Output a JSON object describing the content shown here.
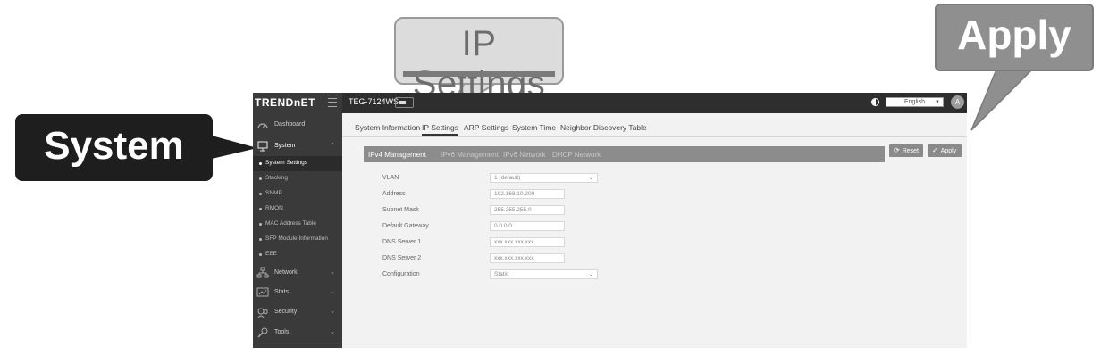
{
  "callouts": {
    "ip_settings": "IP Settings",
    "apply": "Apply",
    "system": "System"
  },
  "app": {
    "logo": "TRENDnET",
    "model": "TEG-7124WS",
    "language": "English",
    "avatar_initial": "A"
  },
  "sidebar": {
    "items": [
      {
        "label": "Dashboard",
        "icon": "dashboard-icon"
      },
      {
        "label": "System",
        "icon": "system-icon"
      },
      {
        "label": "Network",
        "icon": "network-icon"
      },
      {
        "label": "Stats",
        "icon": "stats-icon"
      },
      {
        "label": "Security",
        "icon": "security-icon"
      },
      {
        "label": "Tools",
        "icon": "tools-icon"
      }
    ],
    "subitems": [
      {
        "label": "System Settings",
        "active": true
      },
      {
        "label": "Stacking"
      },
      {
        "label": "SNMP"
      },
      {
        "label": "RMON"
      },
      {
        "label": "MAC Address Table"
      },
      {
        "label": "SFP Module Information"
      },
      {
        "label": "EEE"
      }
    ]
  },
  "tabs": [
    {
      "label": "System Information"
    },
    {
      "label": "IP Settings",
      "active": true
    },
    {
      "label": "ARP Settings"
    },
    {
      "label": "System Time"
    },
    {
      "label": "Neighbor Discovery Table"
    }
  ],
  "buttons": {
    "reset": "Reset",
    "apply": "Apply"
  },
  "subtabs": [
    {
      "label": "IPv4 Management",
      "active": true
    },
    {
      "label": "IPv6 Management"
    },
    {
      "label": "IPv6 Network"
    },
    {
      "label": "DHCP Network"
    }
  ],
  "form": [
    {
      "label": "VLAN",
      "value": "1 (default)",
      "type": "select"
    },
    {
      "label": "Address",
      "value": "192.168.10.200",
      "type": "text"
    },
    {
      "label": "Subnet Mask",
      "value": "255.255.255.0",
      "type": "text"
    },
    {
      "label": "Default Gateway",
      "value": "0.0.0.0",
      "type": "text"
    },
    {
      "label": "DNS Server 1",
      "value": "xxx.xxx.xxx.xxx",
      "type": "text"
    },
    {
      "label": "DNS Server 2",
      "value": "xxx.xxx.xxx.xxx",
      "type": "text"
    },
    {
      "label": "Configuration",
      "value": "Static",
      "type": "select"
    }
  ],
  "colors": {
    "sidebar_bg": "#3a3a3a",
    "topbar_bg": "#2e2e2e",
    "subtab_bar": "#8c8c8c",
    "callout_dark": "#1e1e1e",
    "callout_light": "#dcdcdc"
  }
}
